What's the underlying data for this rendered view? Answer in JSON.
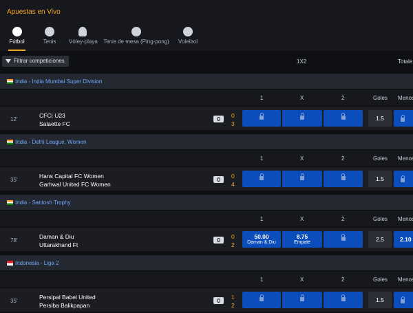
{
  "header": {
    "title": "Apuestas en Vivo"
  },
  "sports": [
    {
      "label": "Fútbol",
      "icon": "soccer-ball-icon",
      "active": true
    },
    {
      "label": "Tenis",
      "icon": "tennis-ball-icon",
      "active": false
    },
    {
      "label": "Vóley-playa",
      "icon": "beach-volley-icon",
      "active": false
    },
    {
      "label": "Tenis de mesa (Ping-pong)",
      "icon": "table-tennis-icon",
      "active": false
    },
    {
      "label": "Voleibol",
      "icon": "volleyball-icon",
      "active": false
    }
  ],
  "filter": {
    "label": "Filtrar competiciones"
  },
  "columns": {
    "group_1x2": "1X2",
    "group_totals": "Totale",
    "one": "1",
    "draw": "X",
    "two": "2",
    "goals": "Goles",
    "under": "Menos"
  },
  "leagues": [
    {
      "name": "India - India Mumbai Super Division",
      "flag": "india-flag",
      "match": {
        "time": "12'",
        "home": "CFCI U23",
        "away": "Salaette FC",
        "home_score": "0",
        "away_score": "3",
        "odd_1": "",
        "odd_1_label": "",
        "odd_x": "",
        "odd_x_label": "",
        "odd_2": "",
        "goals": "1.5",
        "under": ""
      }
    },
    {
      "name": "India - Delhi League, Women",
      "flag": "india-flag",
      "match": {
        "time": "35'",
        "home": "Hans Capital FC Women",
        "away": "Garhwal United FC Women",
        "home_score": "0",
        "away_score": "4",
        "odd_1": "",
        "odd_1_label": "",
        "odd_x": "",
        "odd_x_label": "",
        "odd_2": "",
        "goals": "1.5",
        "under": ""
      }
    },
    {
      "name": "India - Santosh Trophy",
      "flag": "india-flag",
      "match": {
        "time": "78'",
        "home": "Daman & Diu",
        "away": "Uttarakhand Ft",
        "home_score": "0",
        "away_score": "2",
        "odd_1": "50.00",
        "odd_1_label": "Daman & Diu",
        "odd_x": "8.75",
        "odd_x_label": "Empate",
        "odd_2": "",
        "goals": "2.5",
        "under": "2.10"
      }
    },
    {
      "name": "Indonesia - Liga 2",
      "flag": "indonesia-flag",
      "match": {
        "time": "35'",
        "home": "Persipal Babel United",
        "away": "Persiba Balikpapan",
        "home_score": "1",
        "away_score": "2",
        "odd_1": "",
        "odd_1_label": "",
        "odd_x": "",
        "odd_x_label": "",
        "odd_2": "",
        "goals": "1.5",
        "under": ""
      }
    }
  ]
}
